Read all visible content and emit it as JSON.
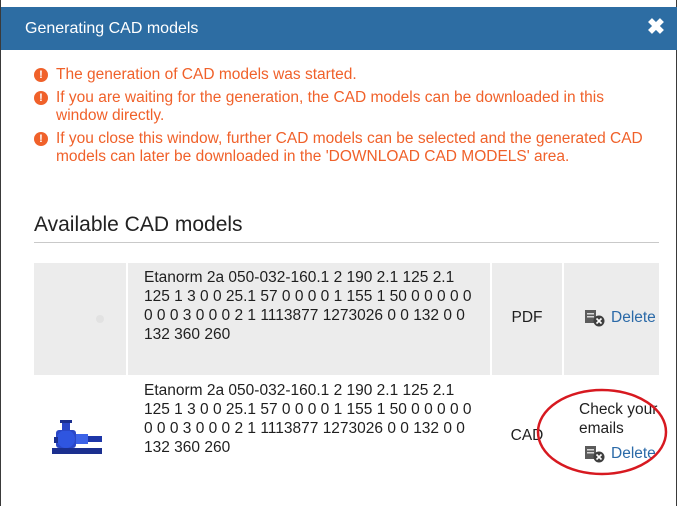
{
  "dialog": {
    "title": "Generating CAD models",
    "close_symbol": "✖"
  },
  "messages": [
    "The generation of CAD models was started.",
    "If you are waiting for the generation, the CAD models can be downloaded in this window directly.",
    "If you close this window, further CAD models can be selected and the generated CAD models can later be downloaded in the 'DOWNLOAD CAD MODELS' area."
  ],
  "alert_symbol": "!",
  "available": {
    "heading": "Available CAD models",
    "rows": [
      {
        "description": "Etanorm 2a 050-032-160.1 2 190 2.1 125 2.1 125 1 3 0 0 25.1 57 0 0 0 0 1 155 1 50 0 0 0 0 0 0 0 0 3 0 0 0 2 1 1113877 1273026 0 0 132 0 0 132 360 260",
        "format": "PDF",
        "status": "",
        "delete_label": "Delete",
        "thumbnail": "none"
      },
      {
        "description": "Etanorm 2a 050-032-160.1 2 190 2.1 125 2.1 125 1 3 0 0 25.1 57 0 0 0 0 1 155 1 50 0 0 0 0 0 0 0 0 3 0 0 0 2 1 1113877 1273026 0 0 132 0 0 132 360 260",
        "format": "CAD",
        "status": "Check your emails",
        "delete_label": "Delete",
        "thumbnail": "pump-image"
      }
    ]
  },
  "colors": {
    "title_bar": "#2d6da3",
    "message_text": "#f0612a",
    "link": "#2b6aa8",
    "highlight_ring": "#d71920"
  },
  "icons": {
    "close": "close-icon",
    "alert": "alert-circle-icon",
    "delete": "delete-file-icon"
  }
}
